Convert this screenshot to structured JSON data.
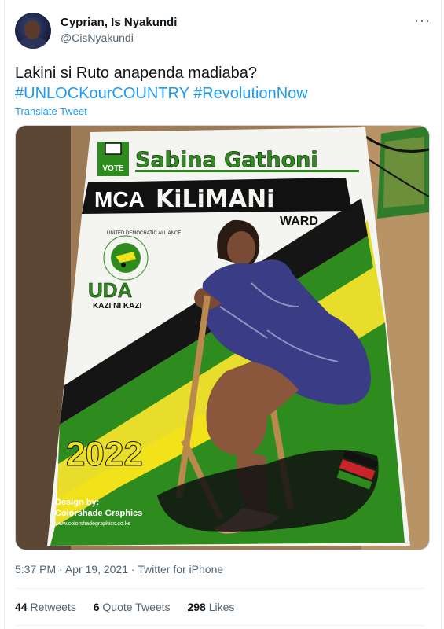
{
  "tweet": {
    "author_name": "Cyprian, Is Nyakundi",
    "author_handle": "@CisNyakundi",
    "more_icon": "more-horizontal-icon",
    "text_line1": "Lakini si Ruto anapenda madiaba?",
    "hashtags": [
      "#UNLOCKourCOUNTRY",
      "#RevolutionNow"
    ],
    "translate_label": "Translate Tweet",
    "time": "5:37 PM",
    "separator": "·",
    "date": "Apr 19, 2021",
    "client": "Twitter for iPhone",
    "retweets_count": "44",
    "retweets_label": "Retweets",
    "quotes_count": "6",
    "quotes_label": "Quote Tweets",
    "likes_count": "298",
    "likes_label": "Likes"
  },
  "poster": {
    "vote_label": "VOTE",
    "candidate_name": "Sabina Gathoni",
    "position": "MCA",
    "ward_name": "KiLiMANi",
    "ward_label": "WARD",
    "party_ring_text": "UNITED DEMOCRATIC ALLIANCE",
    "party_abbrev": "UDA",
    "party_slogan": "KAZI NI KAZI",
    "year": "2022",
    "design_by": "Design by:",
    "designer": "Colorshade Graphics",
    "designer_url": "www.colorshadegraphics.co.ke",
    "colors": {
      "green": "#2e8b1e",
      "yellow": "#f2e21a",
      "black": "#111111",
      "link": "#1d9bf0"
    }
  }
}
